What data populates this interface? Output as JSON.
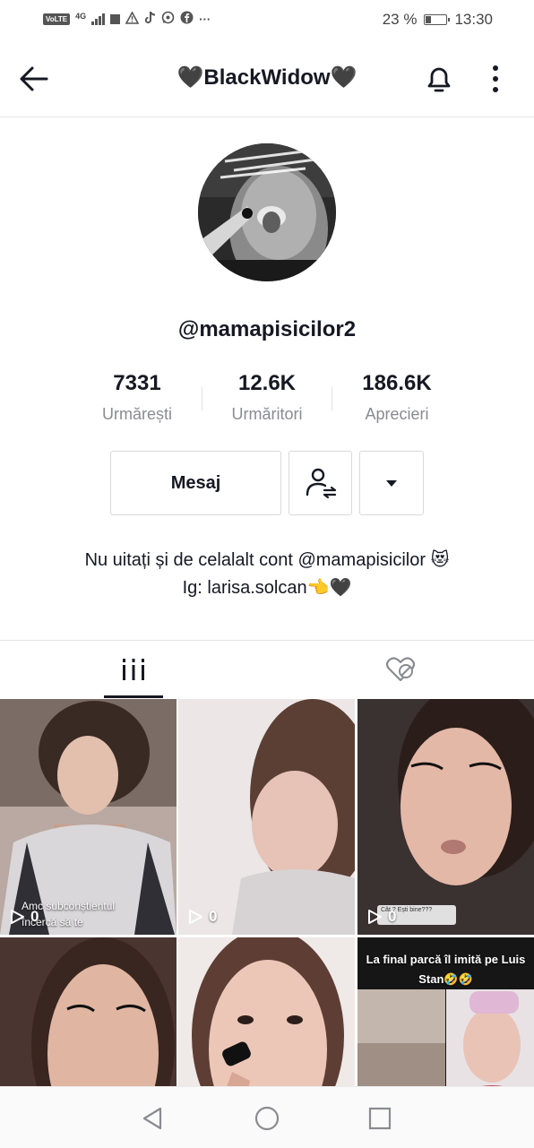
{
  "status_bar": {
    "volte": "VoLTE",
    "network": "4G",
    "battery_pct": "23 %",
    "battery_level": 0.23,
    "time": "13:30",
    "icons": [
      "signal-icon",
      "notification-square-icon",
      "warning-icon",
      "tiktok-icon",
      "whatsapp-icon",
      "facebook-icon",
      "more-notifications-icon"
    ]
  },
  "header": {
    "title": "🖤BlackWidow🖤",
    "icons": [
      "back-arrow-icon",
      "bell-icon",
      "more-vertical-icon"
    ]
  },
  "profile": {
    "username": "@mamapisicilor2",
    "stats": [
      {
        "value": "7331",
        "label": "Urmărești"
      },
      {
        "value": "12.6K",
        "label": "Urmăritori"
      },
      {
        "value": "186.6K",
        "label": "Aprecieri"
      }
    ],
    "message_button": "Mesaj",
    "bio_line1": "Nu uitați și de celalalt cont @mamapisicilor 😻",
    "bio_line2": "Ig: larisa.solcan👈🖤"
  },
  "tabs": {
    "icons": [
      "videos-grid-icon",
      "liked-hidden-icon"
    ],
    "active": "videos"
  },
  "videos": [
    {
      "views": "0",
      "caption": "Amc subconștientul încercă să te"
    },
    {
      "views": "0",
      "caption": ""
    },
    {
      "views": "0",
      "caption": "Cât ? Ești bine???"
    },
    {
      "views": "",
      "caption": ""
    },
    {
      "views": "",
      "caption": ""
    },
    {
      "views": "",
      "caption": "La final parcă îl imită pe Luis Stan🤣🤣"
    }
  ],
  "nav": {
    "icons": [
      "nav-back-icon",
      "nav-home-icon",
      "nav-recents-icon"
    ]
  },
  "colors": {
    "text_primary": "#161823",
    "text_secondary": "#8a8b91",
    "divider": "#e3e3e4"
  }
}
